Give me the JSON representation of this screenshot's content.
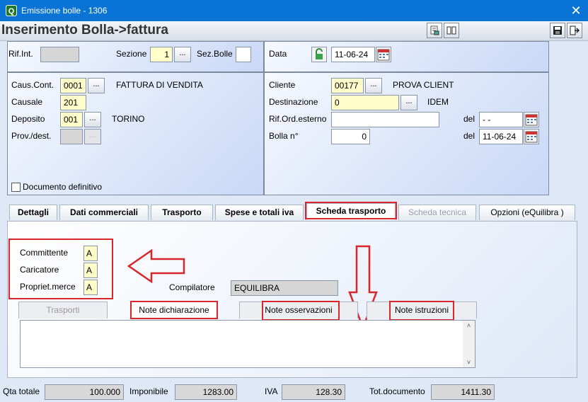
{
  "window": {
    "title": "Emissione bolle - 1306",
    "app_icon": "Q"
  },
  "header": {
    "title": "Inserimento Bolla->fattura"
  },
  "top_left": {
    "rif_int_label": "Rif.Int.",
    "sezione_label": "Sezione",
    "sezione_value": "1",
    "sez_bolle_label": "Sez.Bolle"
  },
  "top_right": {
    "data_label": "Data",
    "data_value": "11-06-24"
  },
  "left_panel": {
    "caus_cont_label": "Caus.Cont.",
    "caus_cont_value": "0001",
    "caus_cont_desc": "FATTURA DI VENDITA",
    "causale_label": "Causale",
    "causale_value": "201",
    "deposito_label": "Deposito",
    "deposito_value": "001",
    "deposito_desc": "TORINO",
    "prov_dest_label": "Prov./dest.",
    "documento_definitivo_label": "Documento definitivo"
  },
  "right_panel": {
    "cliente_label": "Cliente",
    "cliente_value": "00177",
    "cliente_desc": "PROVA CLIENT",
    "destinazione_label": "Destinazione",
    "destinazione_value": "0",
    "destinazione_desc": "IDEM",
    "rif_ord_label": "Rif.Ord.esterno",
    "rif_ord_value": "",
    "del_label": "del",
    "rif_ord_date": "- -",
    "bolla_label": "Bolla   n°",
    "bolla_value": "0",
    "bolla_del_label": "del",
    "bolla_date": "11-06-24"
  },
  "tabs": [
    {
      "label": "Dettagli"
    },
    {
      "label": "Dati commerciali"
    },
    {
      "label": "Trasporto"
    },
    {
      "label": "Spese e totali iva"
    },
    {
      "label": "Scheda trasporto"
    },
    {
      "label": "Scheda tecnica"
    },
    {
      "label": "Opzioni (eQuilibra )"
    }
  ],
  "scheda_trasporto": {
    "committente_label": "Committente",
    "committente_value": "A",
    "caricatore_label": "Caricatore",
    "caricatore_value": "A",
    "propriet_label": "Propriet.merce",
    "propriet_value": "A",
    "compilatore_label": "Compilatore",
    "compilatore_value": "EQUILIBRA",
    "subtabs": [
      {
        "label": "Trasporti"
      },
      {
        "label": "Note dichiarazione"
      },
      {
        "label": "Note osservazioni"
      },
      {
        "label": "Note istruzioni"
      }
    ]
  },
  "footer": {
    "qta_label": "Qta totale",
    "qta_value": "100.000",
    "imponibile_label": "Imponibile",
    "imponibile_value": "1283.00",
    "iva_label": "IVA",
    "iva_value": "128.30",
    "totdoc_label": "Tot.documento",
    "totdoc_value": "1411.30"
  },
  "colors": {
    "titlebar": "#0a74d6",
    "annotation": "#d8262c",
    "field_yellow": "#fffdc9"
  }
}
